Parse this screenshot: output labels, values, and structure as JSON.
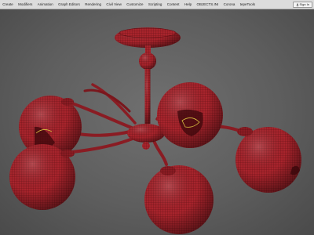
{
  "menubar": {
    "items": [
      "Create",
      "Modifiers",
      "Animation",
      "Graph Editors",
      "Rendering",
      "Civil View",
      "Customize",
      "Scripting",
      "Content",
      "Help",
      "OBJECTS.INI",
      "Corona",
      "tepeTools"
    ],
    "signin_label": "Sign In"
  },
  "viewport": {
    "object": "ceiling-chandelier-wireframe",
    "mesh_color": "#a8242c",
    "wire_color": "#5a0d12",
    "background_color": "#5e5e5e"
  }
}
